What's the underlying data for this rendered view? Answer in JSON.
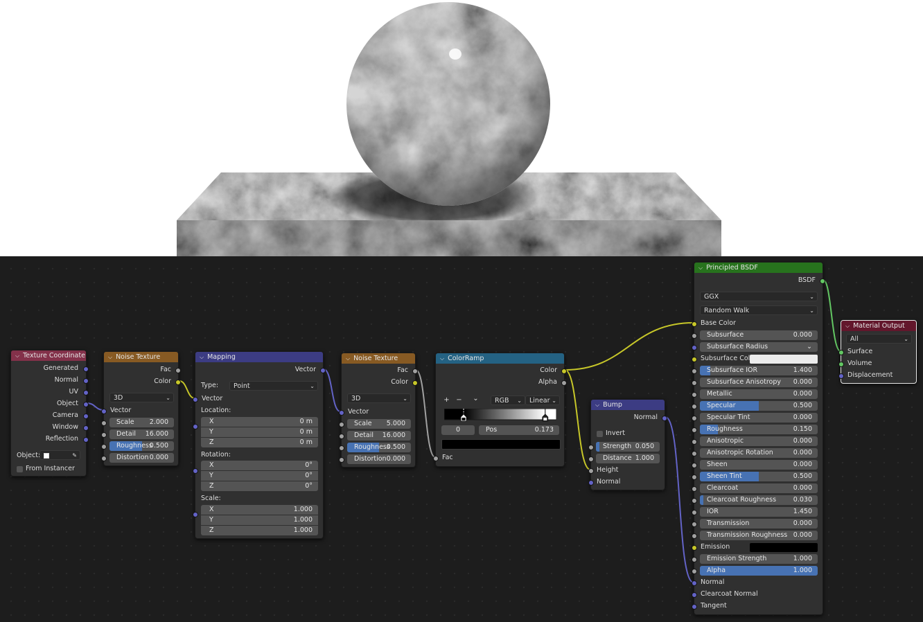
{
  "colors": {
    "input_header": "#83314a",
    "texture_header": "#875a23",
    "vector_header": "#3c3c83",
    "converter_header": "#246283",
    "shader_header": "#27721d",
    "output_header": "#63172c",
    "socket_float": "#a1a1a1",
    "socket_vector": "#6363c7",
    "socket_color": "#c7c729",
    "socket_shader": "#63c763",
    "slider_fill": "#4772b3"
  },
  "texcoord": {
    "title": "Texture Coordinate",
    "outputs": [
      "Generated",
      "Normal",
      "UV",
      "Object",
      "Camera",
      "Window",
      "Reflection"
    ],
    "object_label": "Object:",
    "from_instancer": "From Instancer",
    "eyedropper_icon": "eyedropper-icon"
  },
  "noise1": {
    "title": "Noise Texture",
    "out_fac": "Fac",
    "out_color": "Color",
    "dimensions": "3D",
    "in_vector": "Vector",
    "scale": {
      "label": "Scale",
      "value": "2.000"
    },
    "detail": {
      "label": "Detail",
      "value": "16.000"
    },
    "roughness": {
      "label": "Roughness",
      "value": "0.500",
      "fraction": 0.5
    },
    "distortion": {
      "label": "Distortion",
      "value": "0.000"
    }
  },
  "mapping": {
    "title": "Mapping",
    "out_vector": "Vector",
    "type_label": "Type:",
    "type_value": "Point",
    "in_vector": "Vector",
    "location_label": "Location:",
    "location": [
      {
        "axis": "X",
        "value": "0 m"
      },
      {
        "axis": "Y",
        "value": "0 m"
      },
      {
        "axis": "Z",
        "value": "0 m"
      }
    ],
    "rotation_label": "Rotation:",
    "rotation": [
      {
        "axis": "X",
        "value": "0°"
      },
      {
        "axis": "Y",
        "value": "0°"
      },
      {
        "axis": "Z",
        "value": "0°"
      }
    ],
    "scale_label": "Scale:",
    "scale": [
      {
        "axis": "X",
        "value": "1.000"
      },
      {
        "axis": "Y",
        "value": "1.000"
      },
      {
        "axis": "Z",
        "value": "1.000"
      }
    ]
  },
  "noise2": {
    "title": "Noise Texture",
    "out_fac": "Fac",
    "out_color": "Color",
    "dimensions": "3D",
    "in_vector": "Vector",
    "scale": {
      "label": "Scale",
      "value": "5.000"
    },
    "detail": {
      "label": "Detail",
      "value": "16.000"
    },
    "roughness": {
      "label": "Roughness",
      "value": "0.500",
      "fraction": 0.5
    },
    "distortion": {
      "label": "Distortion",
      "value": "0.000"
    }
  },
  "colorramp": {
    "title": "ColorRamp",
    "out_color": "Color",
    "out_alpha": "Alpha",
    "add_icon": "+",
    "remove_icon": "−",
    "menu_icon": "⌄",
    "color_mode": "RGB",
    "interpolation": "Linear",
    "stop_index": "0",
    "pos_label": "Pos",
    "pos_value": "0.173",
    "stops": [
      0.173,
      0.9
    ],
    "in_fac": "Fac"
  },
  "bump": {
    "title": "Bump",
    "out_normal": "Normal",
    "invert": "Invert",
    "strength": {
      "label": "Strength",
      "value": "0.050",
      "fraction": 0.05
    },
    "distance": {
      "label": "Distance",
      "value": "1.000"
    },
    "in_height": "Height",
    "in_normal": "Normal"
  },
  "bsdf": {
    "title": "Principled BSDF",
    "out_bsdf": "BSDF",
    "distribution": "GGX",
    "subsurface_method": "Random Walk",
    "base_color": "Base Color",
    "subsurface": {
      "label": "Subsurface",
      "value": "0.000"
    },
    "subsurface_radius": "Subsurface Radius",
    "subsurface_col": "Subsurface Col",
    "subsurface_ior": {
      "label": "Subsurface IOR",
      "value": "1.400",
      "fraction": 0.09
    },
    "subsurface_anisotropy": {
      "label": "Subsurface Anisotropy",
      "value": "0.000"
    },
    "metallic": {
      "label": "Metallic",
      "value": "0.000"
    },
    "specular": {
      "label": "Specular",
      "value": "0.500",
      "fraction": 0.5
    },
    "specular_tint": {
      "label": "Specular Tint",
      "value": "0.000"
    },
    "roughness": {
      "label": "Roughness",
      "value": "0.150",
      "fraction": 0.15
    },
    "anisotropic": {
      "label": "Anisotropic",
      "value": "0.000"
    },
    "anisotropic_rotation": {
      "label": "Anisotropic Rotation",
      "value": "0.000"
    },
    "sheen": {
      "label": "Sheen",
      "value": "0.000"
    },
    "sheen_tint": {
      "label": "Sheen Tint",
      "value": "0.500",
      "fraction": 0.5
    },
    "clearcoat": {
      "label": "Clearcoat",
      "value": "0.000"
    },
    "clearcoat_roughness": {
      "label": "Clearcoat Roughness",
      "value": "0.030",
      "fraction": 0.03
    },
    "ior": {
      "label": "IOR",
      "value": "1.450"
    },
    "transmission": {
      "label": "Transmission",
      "value": "0.000"
    },
    "transmission_roughness": {
      "label": "Transmission Roughness",
      "value": "0.000"
    },
    "emission": "Emission",
    "emission_strength": {
      "label": "Emission Strength",
      "value": "1.000"
    },
    "alpha": {
      "label": "Alpha",
      "value": "1.000",
      "fraction": 1.0
    },
    "normal": "Normal",
    "clearcoat_normal": "Clearcoat Normal",
    "tangent": "Tangent"
  },
  "output": {
    "title": "Material Output",
    "target": "All",
    "surface": "Surface",
    "volume": "Volume",
    "displacement": "Displacement"
  }
}
